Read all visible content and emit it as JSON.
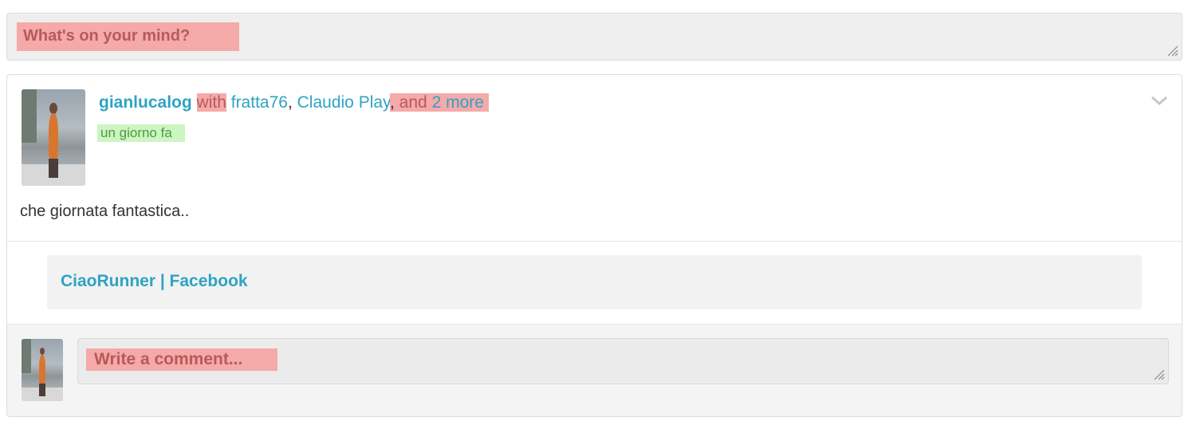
{
  "composer": {
    "placeholder": "What's on your mind?"
  },
  "post": {
    "author": "gianlucalog",
    "with_word": "with",
    "tagged": [
      "fratta76",
      "Claudio Play"
    ],
    "comma": ",",
    "and_word": "and",
    "more_link": "2 more",
    "timestamp": "un giorno fa",
    "text": "che giornata fantastica..",
    "link_preview_title": "CiaoRunner | Facebook",
    "menu_icon": "chevron-down-icon"
  },
  "comment": {
    "placeholder": "Write a comment..."
  },
  "colors": {
    "link": "#2ea3c3",
    "highlight_red": "#f5a9a9",
    "highlight_green": "#ccf5c2"
  }
}
